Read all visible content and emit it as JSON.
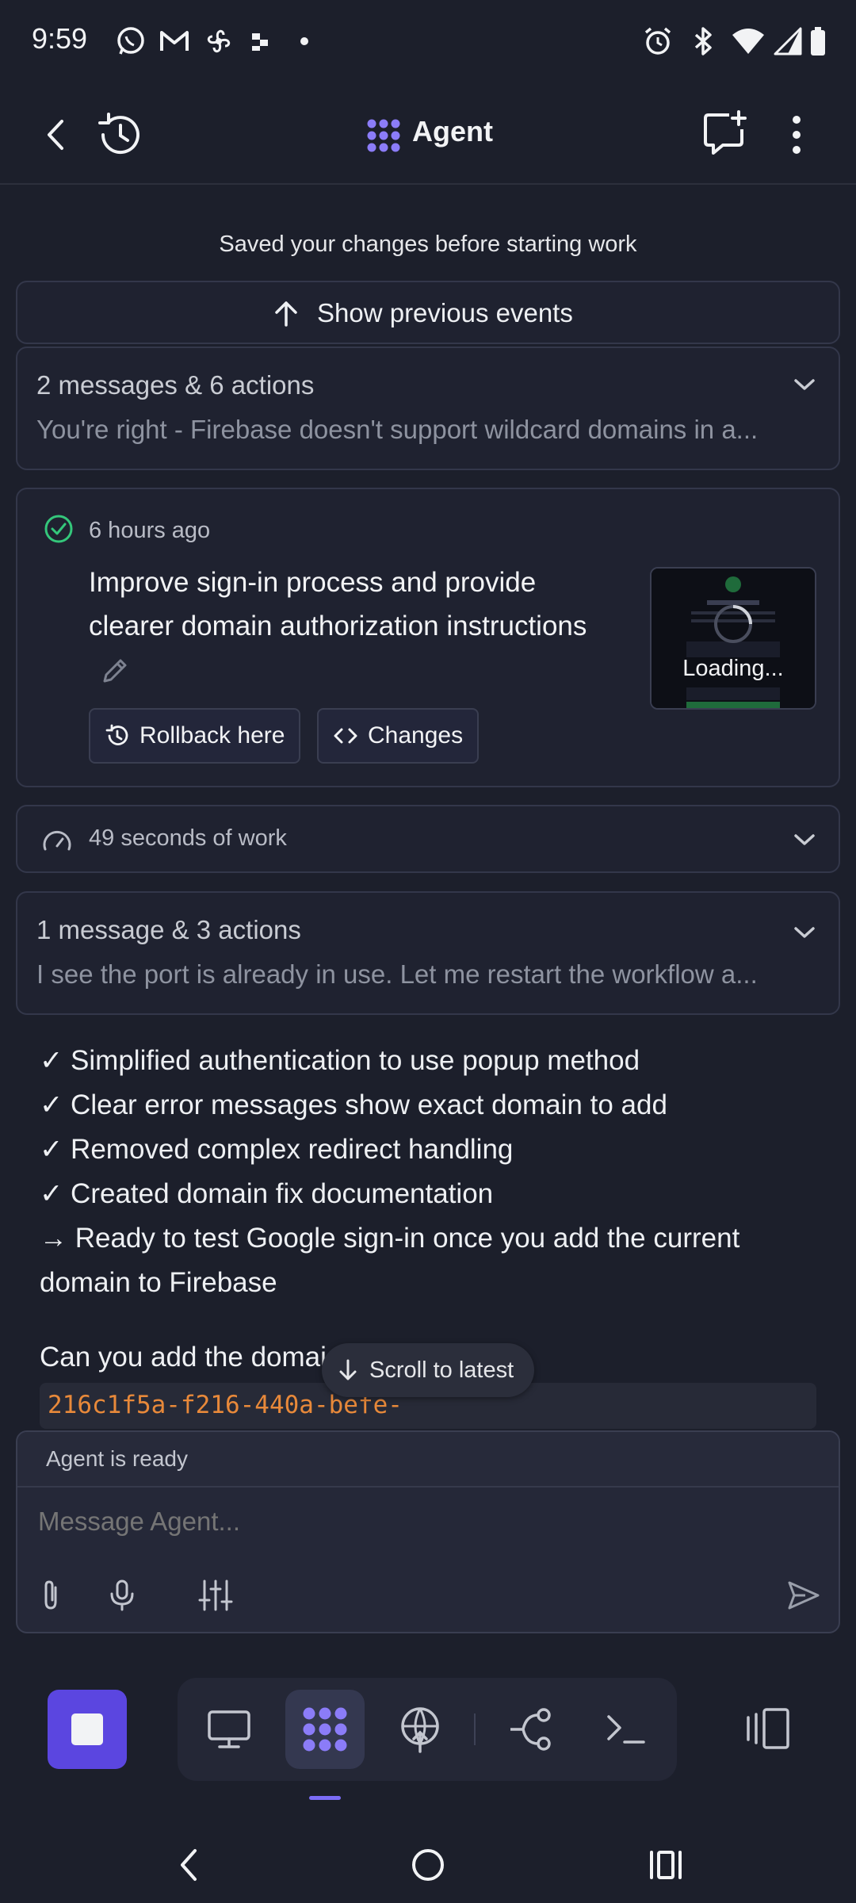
{
  "status_bar": {
    "time": "9:59",
    "left_icons": [
      "whatsapp-icon",
      "gmail-icon",
      "pinwheel-icon",
      "app-icon",
      "dot-icon"
    ],
    "right_icons": [
      "alarm-icon",
      "bluetooth-icon",
      "wifi-icon",
      "signal-icon",
      "battery-icon"
    ]
  },
  "header": {
    "title": "Agent",
    "icons": [
      "back-icon",
      "history-icon",
      "agent-logo-icon",
      "new-chat-icon",
      "more-vert-icon"
    ]
  },
  "timeline": {
    "saved_note": "Saved your changes before starting work",
    "show_previous": "Show previous events",
    "group1": {
      "title": "2 messages & 6 actions",
      "preview": "You're right - Firebase doesn't support wildcard domains in a..."
    },
    "checkpoint": {
      "time": "6 hours ago",
      "title": "Improve sign-in process and provide clearer domain authorization instructions",
      "rollback_label": "Rollback here",
      "changes_label": "Changes",
      "thumbnail_label": "Loading..."
    },
    "work": {
      "label": "49 seconds of work"
    },
    "group2": {
      "title": "1 message & 3 actions",
      "preview": "I see the port is already in use. Let me restart the workflow a..."
    },
    "summary_lines": [
      "✓ Simplified authentication to use popup method",
      "✓ Clear error messages show exact domain to add",
      "✓ Removed complex redirect handling",
      "✓ Created domain fix documentation",
      "→ Ready to test Google sign-in once you add the current domain to Firebase"
    ],
    "ask_text": "Can you add the domai",
    "code_text": "216c1f5a-f216-440a-befe-",
    "scroll_to_latest": "Scroll to latest"
  },
  "composer": {
    "status": "Agent is ready",
    "placeholder": "Message Agent...",
    "icons": [
      "attach-icon",
      "mic-icon",
      "settings-sliders-icon",
      "send-icon"
    ]
  },
  "bottom_toolbar": {
    "tabs": [
      "webview-icon",
      "agent-icon",
      "deploy-icon",
      "git-icon",
      "shell-icon"
    ],
    "active_tab": "agent-icon"
  },
  "colors": {
    "background": "#1c1f2b",
    "accent": "#7b6cf6",
    "stop_button": "#5b46e0",
    "success": "#34c77b",
    "code": "#e8893a"
  }
}
